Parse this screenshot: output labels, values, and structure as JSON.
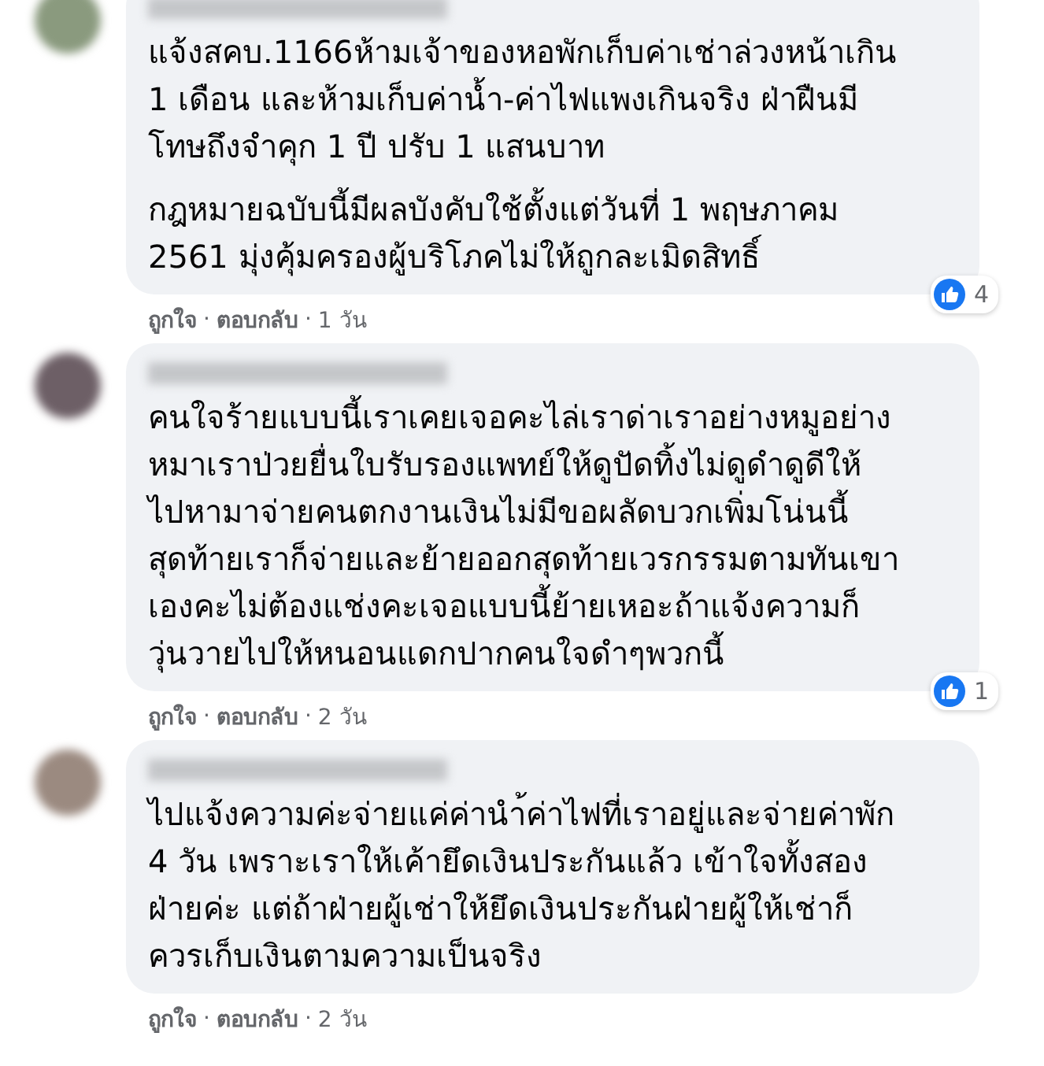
{
  "comments": [
    {
      "paragraphs": [
        [
          "แจ้งสคบ.1166ห้ามเจ้าของหอพักเก็บค่าเช่าล่วงหน้าเกิน",
          "1 เดือน และห้ามเก็บค่าน้ำ-ค่าไฟแพงเกินจริง ฝ่าฝืนมี",
          "โทษถึงจำคุก 1 ปี ปรับ 1 แสนบาท"
        ],
        [
          "กฎหมายฉบับนี้มีผลบังคับใช้ตั้งแต่วันที่ 1 พฤษภาคม",
          "2561 มุ่งคุ้มครองผู้บริโภคไม่ให้ถูกละเมิดสิทธิ์"
        ]
      ],
      "reactions": "4",
      "like": "ถูกใจ",
      "separators": [
        "·",
        "·"
      ],
      "reply": "ตอบกลับ",
      "time": "1 วัน"
    },
    {
      "paragraphs": [
        [
          "คนใจร้ายแบบนี้เราเคยเจอคะไล่เราด่าเราอย่างหมูอย่าง",
          "หมาเราป่วยยื่นใบรับรองแพทย์ให้ดูปัดทิ้งไม่ดูดำดูดีให้",
          "ไปหามาจ่ายคนตกงานเงินไม่มีขอผลัดบวกเพิ่มโน่นนี้",
          "สุดท้ายเราก็จ่ายและย้ายออกสุดท้ายเวรกรรมตามทันเขา",
          "เองคะไม่ต้องแช่งคะเจอแบบนี้ย้ายเหอะถ้าแจ้งความก็",
          "วุ่นวายไปให้หนอนแดกปากคนใจดำๆพวกนี้"
        ]
      ],
      "reactions": "1",
      "like": "ถูกใจ",
      "separators": [
        "·",
        "·"
      ],
      "reply": "ตอบกลับ",
      "time": "2 วัน"
    },
    {
      "paragraphs": [
        [
          "ไปแจ้งความค่ะจ่ายแค่ค่านำ้ค่าไฟที่เราอยู่และจ่ายค่าพัก",
          "4 วัน เพราะเราให้เค้ายึดเงินประกันแล้ว เข้าใจทั้งสอง",
          "ฝ่ายค่ะ แต่ถ้าฝ่ายผู้เช่าให้ยึดเงินประกันฝ่ายผู้ให้เช่าก็",
          "ควรเก็บเงินตามความเป็นจริง"
        ]
      ],
      "like": "ถูกใจ",
      "separators": [
        "·",
        "·"
      ],
      "reply": "ตอบกลับ",
      "time": "2 วัน"
    }
  ]
}
